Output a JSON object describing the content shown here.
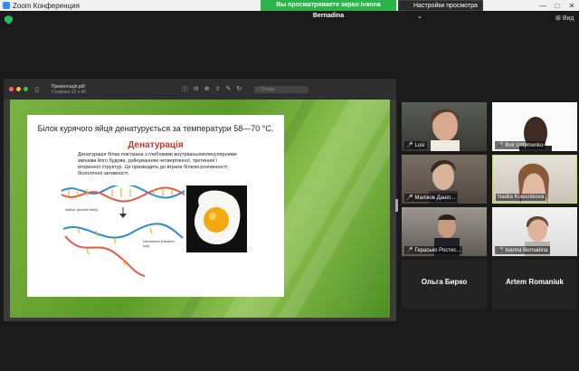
{
  "window": {
    "title": "Zoom Конференция",
    "minimize": "—",
    "maximize": "□",
    "close": "✕"
  },
  "share_banner": "Вы просматриваете экран Ivanna Bernadina",
  "view_options": "Настройки просмотра",
  "view_button": "Вид",
  "pdf": {
    "filename": "Презентація.pdf",
    "page_info": "Сторінка 12 з 40",
    "search_placeholder": "Пошук"
  },
  "slide": {
    "title": "Білок курячого яйця денатурується за температури 58—70 °С.",
    "heading": "Денатурація",
    "body": "Денатурація білка пов’язана з глибокими внутрішньомолекулярними змінами його будови, руйнуванням четвертинної, третинної і вторинної структур. Це призводить до втрати білком розчинності, біологічної активності.",
    "label_native": "Native (double helix)",
    "label_denatured": "Denatured (random coil)"
  },
  "participants": [
    {
      "name": "Lusi",
      "muted": true
    },
    {
      "name": "Ihor Ustymenko",
      "muted": true
    },
    {
      "name": "Маліков Даніл...",
      "muted": true
    },
    {
      "name": "Nadiia Kolesnikova",
      "muted": false,
      "active": true
    },
    {
      "name": "Герасько Ростис...",
      "muted": true
    },
    {
      "name": "Ivanna Bernadina",
      "muted": true
    },
    {
      "name": "Ольга Бирко",
      "muted": false,
      "video_off": true
    },
    {
      "name": "Artem Romaniuk",
      "muted": false,
      "video_off": true
    }
  ],
  "colors": {
    "share_green": "#2cb34a",
    "active_border": "#c8e64a",
    "mute_red": "#e23a3a"
  }
}
